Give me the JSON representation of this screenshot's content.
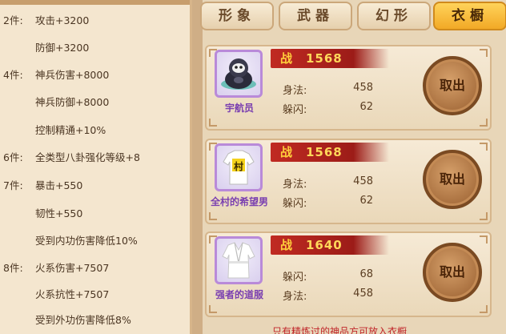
{
  "set_bonuses": [
    {
      "count": "2件:",
      "text": "攻击+3200"
    },
    {
      "count": "",
      "text": "防御+3200"
    },
    {
      "count": "4件:",
      "text": "神兵伤害+8000"
    },
    {
      "count": "",
      "text": "神兵防御+8000"
    },
    {
      "count": "",
      "text": "控制精通+10%"
    },
    {
      "count": "6件:",
      "text": "全类型八卦强化等级+8"
    },
    {
      "count": "7件:",
      "text": "暴击+550"
    },
    {
      "count": "",
      "text": "韧性+550"
    },
    {
      "count": "",
      "text": "受到内功伤害降低10%"
    },
    {
      "count": "8件:",
      "text": "火系伤害+7507"
    },
    {
      "count": "",
      "text": "火系抗性+7507"
    },
    {
      "count": "",
      "text": "受到外功伤害降低8%"
    }
  ],
  "tabs": [
    {
      "label": "形象",
      "active": false
    },
    {
      "label": "武器",
      "active": false
    },
    {
      "label": "幻形",
      "active": false
    },
    {
      "label": "衣橱",
      "active": true
    }
  ],
  "items": [
    {
      "name": "宇航员",
      "icon": "astronaut-icon",
      "power_label": "战",
      "power": "1568",
      "stats": [
        {
          "label": "身法:",
          "value": "458"
        },
        {
          "label": "躲闪:",
          "value": "62"
        }
      ],
      "button": "取出"
    },
    {
      "name": "全村的希望男",
      "icon": "village-hope-shirt-icon",
      "shirt_char": "村",
      "power_label": "战",
      "power": "1568",
      "stats": [
        {
          "label": "身法:",
          "value": "458"
        },
        {
          "label": "躲闪:",
          "value": "62"
        }
      ],
      "button": "取出"
    },
    {
      "name": "强者的道服",
      "icon": "martial-robe-icon",
      "power_label": "战",
      "power": "1640",
      "stats": [
        {
          "label": "躲闪:",
          "value": "68"
        },
        {
          "label": "身法:",
          "value": "458"
        }
      ],
      "button": "取出"
    }
  ],
  "bottom_note": "只有精炼过的神品方可放入衣橱",
  "colors": {
    "accent_tab": "#f2a926",
    "power_bar": "#c02a22",
    "item_name": "#7a3fb0",
    "note_text": "#c0262a"
  }
}
